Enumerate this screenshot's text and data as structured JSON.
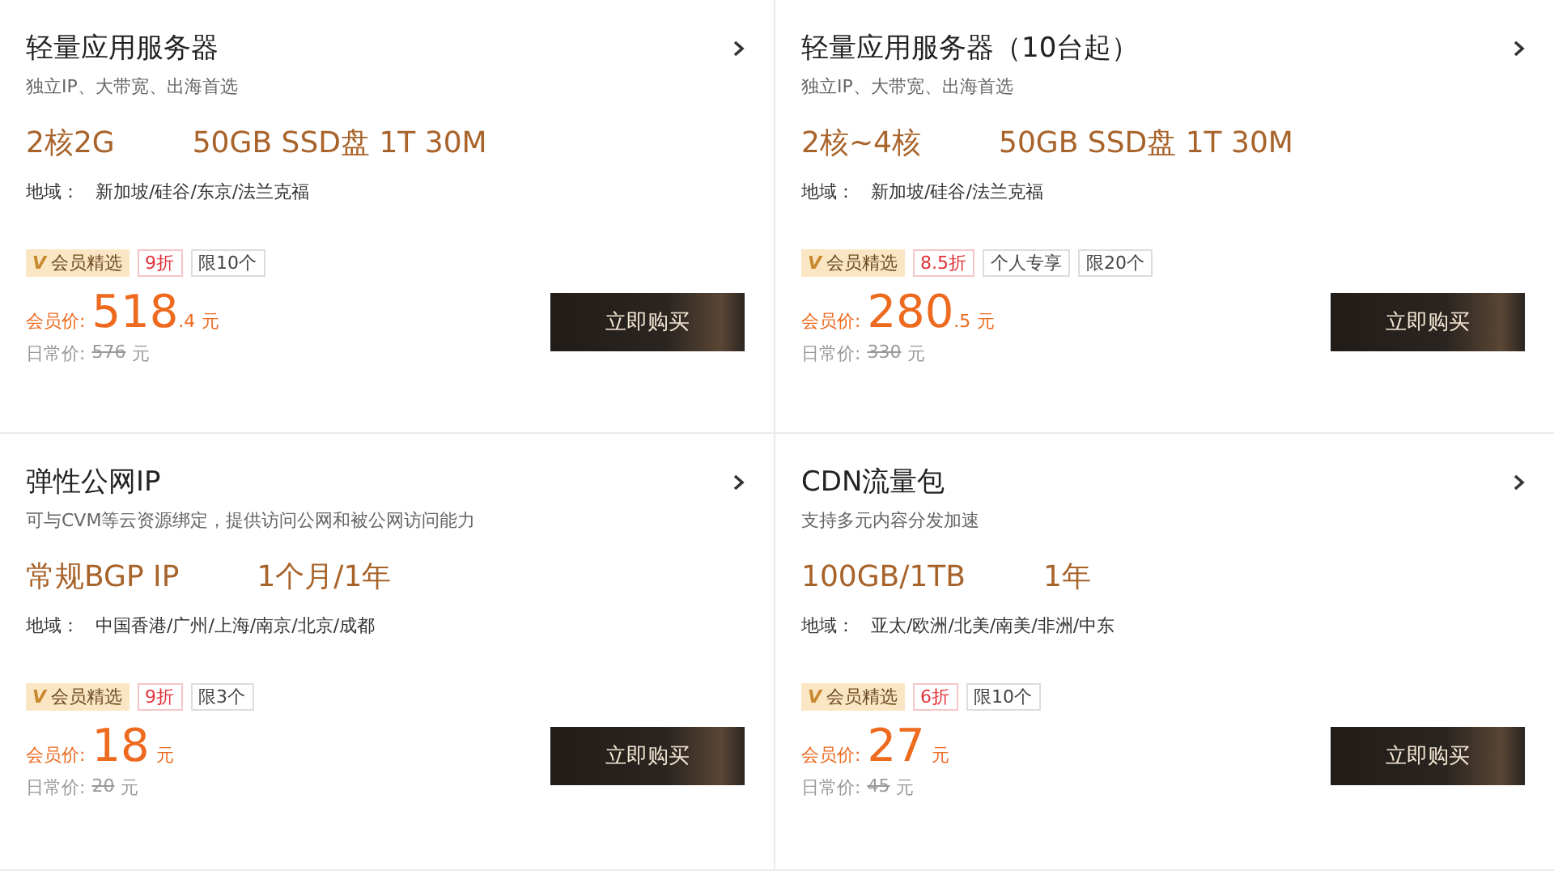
{
  "cards": [
    {
      "title": "轻量应用服务器",
      "subtitle": "独立IP、大带宽、出海首选",
      "specs": [
        "2核2G",
        "50GB SSD盘 1T 30M"
      ],
      "region_label": "地域：",
      "region": "新加坡/硅谷/东京/法兰克福",
      "tags": [
        {
          "kind": "member",
          "mark": "V",
          "label": "会员精选"
        },
        {
          "kind": "discount",
          "label": "9折"
        },
        {
          "kind": "plain",
          "label": "限10个"
        }
      ],
      "price_label": "会员价:",
      "price_int": "518",
      "price_dec": ".4",
      "currency": "元",
      "regular_label": "日常价:",
      "regular_price": "576",
      "regular_currency": "元",
      "button": "立即购买"
    },
    {
      "title": "轻量应用服务器（10台起）",
      "subtitle": "独立IP、大带宽、出海首选",
      "specs": [
        "2核~4核",
        "50GB SSD盘 1T 30M"
      ],
      "region_label": "地域：",
      "region": "新加坡/硅谷/法兰克福",
      "tags": [
        {
          "kind": "member",
          "mark": "V",
          "label": "会员精选"
        },
        {
          "kind": "discount",
          "label": "8.5折"
        },
        {
          "kind": "plain",
          "label": "个人专享"
        },
        {
          "kind": "plain",
          "label": "限20个"
        }
      ],
      "price_label": "会员价:",
      "price_int": "280",
      "price_dec": ".5",
      "currency": "元",
      "regular_label": "日常价:",
      "regular_price": "330",
      "regular_currency": "元",
      "button": "立即购买"
    },
    {
      "title": "弹性公网IP",
      "subtitle": "可与CVM等云资源绑定，提供访问公网和被公网访问能力",
      "specs": [
        "常规BGP IP",
        "1个月/1年"
      ],
      "region_label": "地域：",
      "region": "中国香港/广州/上海/南京/北京/成都",
      "tags": [
        {
          "kind": "member",
          "mark": "V",
          "label": "会员精选"
        },
        {
          "kind": "discount",
          "label": "9折"
        },
        {
          "kind": "plain",
          "label": "限3个"
        }
      ],
      "price_label": "会员价:",
      "price_int": "18",
      "currency": "元",
      "regular_label": "日常价:",
      "regular_price": "20",
      "regular_currency": "元",
      "button": "立即购买"
    },
    {
      "title": "CDN流量包",
      "subtitle": "支持多元内容分发加速",
      "specs": [
        "100GB/1TB",
        "1年"
      ],
      "region_label": "地域：",
      "region": "亚太/欧洲/北美/南美/非洲/中东",
      "tags": [
        {
          "kind": "member",
          "mark": "V",
          "label": "会员精选"
        },
        {
          "kind": "discount",
          "label": "6折"
        },
        {
          "kind": "plain",
          "label": "限10个"
        }
      ],
      "price_label": "会员价:",
      "price_int": "27",
      "currency": "元",
      "regular_label": "日常价:",
      "regular_price": "45",
      "regular_currency": "元",
      "button": "立即购买"
    }
  ]
}
